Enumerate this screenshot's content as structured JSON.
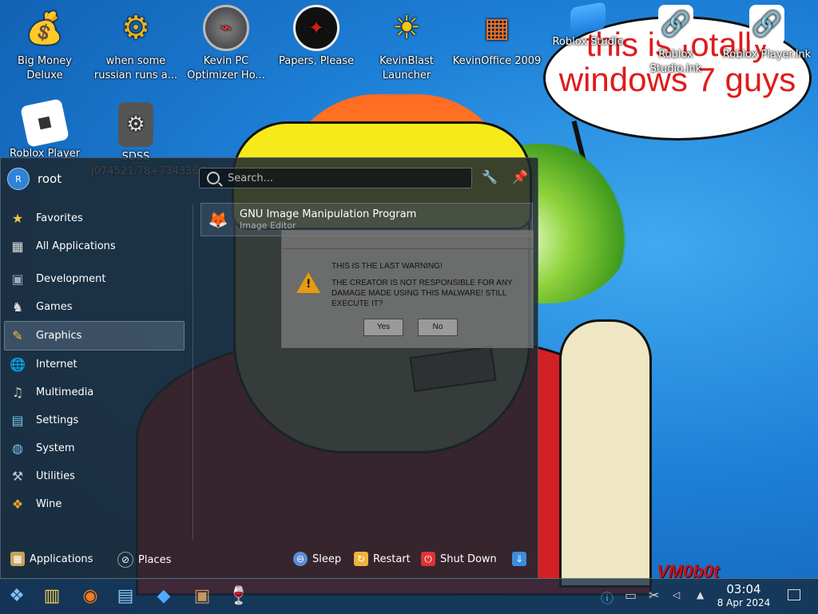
{
  "wallpaper": {
    "bubble_text": "this is totally windows 7 guys",
    "watermark": "VM0b0t"
  },
  "desktop_icons": [
    {
      "label": "Big Money Deluxe",
      "icon": "money-bag-icon"
    },
    {
      "label": "when some russian runs a...",
      "icon": "gear-icon"
    },
    {
      "label": "Kevin PC Optimizer Ho...",
      "icon": "speedometer-icon"
    },
    {
      "label": "Papers, Please",
      "icon": "red-seal-icon"
    },
    {
      "label": "KevinBlast Launcher",
      "icon": "sun-globe-icon"
    },
    {
      "label": "KevinOffice 2009",
      "icon": "office-logo-icon"
    },
    {
      "label": "Roblox Studio",
      "icon": "roblox-studio-icon"
    },
    {
      "label": "Roblox Studio.lnk",
      "icon": "shortcut-link-icon"
    },
    {
      "label": "Roblox Player.lnk",
      "icon": "shortcut-link-icon"
    },
    {
      "label": "Roblox Player",
      "icon": "roblox-player-icon"
    },
    {
      "label": "SDSS J074521.78+734336.1-...",
      "icon": "settings-file-icon"
    }
  ],
  "start_menu": {
    "user": {
      "initial": "R",
      "name": "root"
    },
    "search_placeholder": "Search...",
    "categories": [
      {
        "label": "Favorites",
        "icon": "favorites-icon"
      },
      {
        "label": "All Applications",
        "icon": "all-apps-icon"
      },
      {
        "label": "Development",
        "icon": "development-icon"
      },
      {
        "label": "Games",
        "icon": "games-icon"
      },
      {
        "label": "Graphics",
        "icon": "graphics-icon",
        "active": true
      },
      {
        "label": "Internet",
        "icon": "internet-icon"
      },
      {
        "label": "Multimedia",
        "icon": "multimedia-icon"
      },
      {
        "label": "Settings",
        "icon": "settings-icon"
      },
      {
        "label": "System",
        "icon": "system-icon"
      },
      {
        "label": "Utilities",
        "icon": "utilities-icon"
      },
      {
        "label": "Wine",
        "icon": "wine-icon"
      }
    ],
    "result": {
      "title": "GNU Image Manipulation Program",
      "subtitle": "Image Editor"
    },
    "footer": {
      "applications": "Applications",
      "places": "Places",
      "sleep": "Sleep",
      "restart": "Restart",
      "shutdown": "Shut Down"
    }
  },
  "dialog": {
    "line1": "THIS IS THE LAST WARNING!",
    "line2": "THE CREATOR IS NOT RESPONSIBLE FOR ANY DAMAGE MADE USING THIS MALWARE! STILL EXECUTE IT?",
    "yes": "Yes",
    "no": "No"
  },
  "taskbar": {
    "time": "03:04",
    "date": "8 Apr 2024"
  }
}
